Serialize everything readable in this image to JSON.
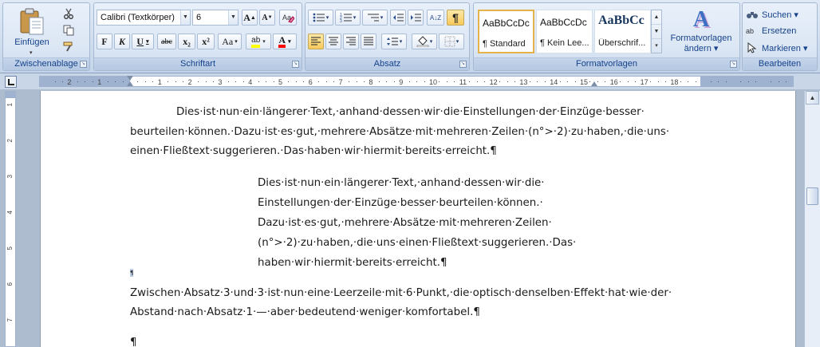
{
  "ribbon": {
    "clipboard": {
      "label": "Zwischenablage",
      "paste_label": "Einfügen",
      "paste_arrow": "▾",
      "cut_icon": "scissors-icon",
      "copy_icon": "copy-icon",
      "format_painter_icon": "format-painter-icon"
    },
    "font": {
      "label": "Schriftart",
      "font_name": "Calibri (Textkörper)",
      "font_size": "6",
      "grow": "A",
      "shrink": "A",
      "bold": "F",
      "italic": "K",
      "underline": "U",
      "strike": "abc",
      "subscript": "x₂",
      "superscript": "x²",
      "change_case": "Aa",
      "highlight": "ab",
      "font_color": "A",
      "highlight_color": "#ffff00",
      "font_color_value": "#ff0000"
    },
    "paragraph": {
      "label": "Absatz",
      "show_marks": "¶",
      "sort": "A↓Z"
    },
    "styles": {
      "label": "Formatvorlagen",
      "items": [
        {
          "sample": "AaBbCcDc",
          "name": "¶ Standard"
        },
        {
          "sample": "AaBbCcDc",
          "name": "¶ Kein Lee..."
        },
        {
          "sample": "AaBbCc",
          "name": "Überschrif..."
        }
      ],
      "change_styles_line1": "Formatvorlagen",
      "change_styles_line2": "ändern ▾",
      "change_styles_glyph": "A",
      "scroll_up": "▲",
      "scroll_down": "▼",
      "scroll_more": "▾"
    },
    "editing": {
      "label": "Bearbeiten",
      "find": "Suchen ▾",
      "replace": "Ersetzen",
      "replace_glyph": "ab",
      "select": "Markieren ▾"
    }
  },
  "ruler": {
    "numbers_left": [
      "2",
      "1"
    ],
    "numbers_right": [
      "1",
      "2",
      "3",
      "4",
      "5",
      "6",
      "7",
      "8",
      "9",
      "10",
      "11",
      "12",
      "13",
      "14",
      "15",
      "16",
      "17",
      "18"
    ]
  },
  "vruler": {
    "numbers": [
      "1",
      "2",
      "3",
      "4",
      "5",
      "6",
      "7"
    ]
  },
  "document": {
    "p1_line1": "Dies·ist·nun·ein·längerer·Text,·anhand·dessen·wir·die·Einstellungen·der·Einzüge·besser·",
    "p1_line2": "beurteilen·können.·Dazu·ist·es·gut,·mehrere·Absätze·mit·mehreren·Zeilen·(n°>·2)·zu·haben,·die·uns·",
    "p1_line3": "einen·Fließtext·suggerieren.·Das·haben·wir·hiermit·bereits·erreicht.¶",
    "p2_line1": "Dies·ist·nun·ein·längerer·Text,·anhand·dessen·wir·die·",
    "p2_line2": "Einstellungen·der·Einzüge·besser·beurteilen·können.·",
    "p2_line3": "Dazu·ist·es·gut,·mehrere·Absätze·mit·mehreren·Zeilen·",
    "p2_line4": "(n°>·2)·zu·haben,·die·uns·einen·Fließtext·suggerieren.·Das·",
    "p2_line5": "haben·wir·hiermit·bereits·erreicht.¶",
    "small_mark": "¶",
    "p3_line1": "Zwischen·Absatz·3·und·3·ist·nun·eine·Leerzeile·mit·6·Punkt,·die·optisch·denselben·Effekt·hat·wie·der·",
    "p3_line2": "Abstand·nach·Absatz·1·—·aber·bedeutend·weniger·komfortabel.¶",
    "p4": "¶"
  }
}
